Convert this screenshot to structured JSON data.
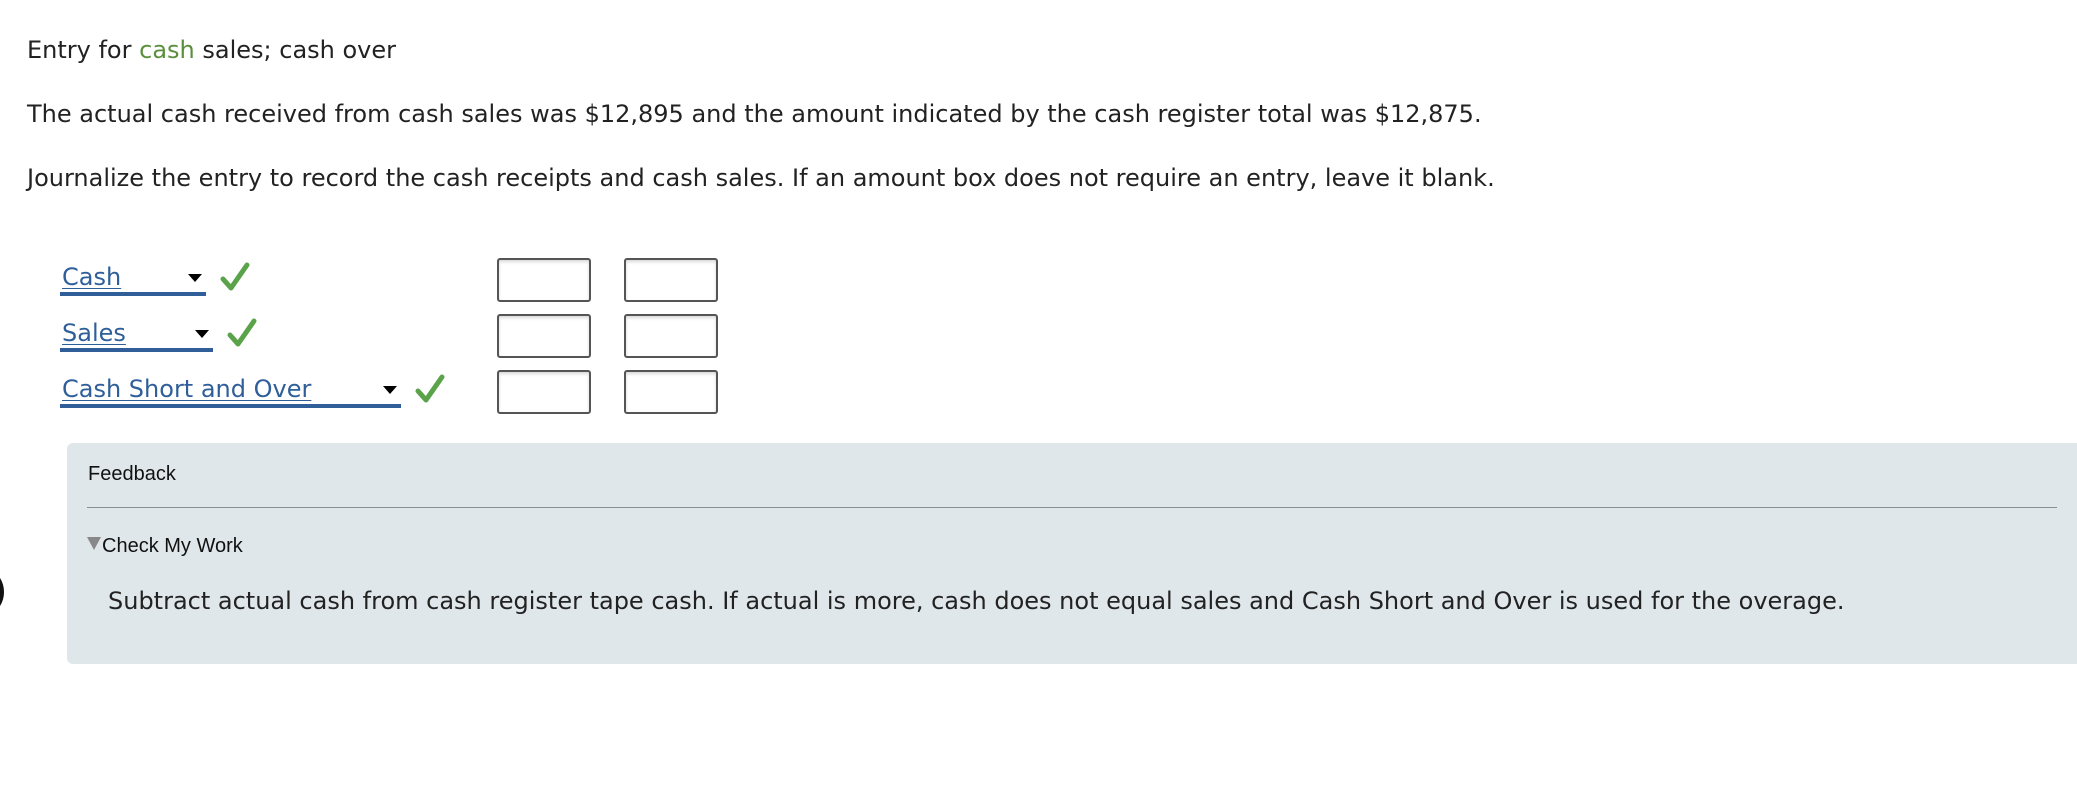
{
  "title": {
    "prefix": "Entry for ",
    "highlight": "cash",
    "suffix": " sales; cash over"
  },
  "paragraphs": {
    "facts": "The actual cash received from cash sales was $12,895 and the amount indicated by the cash register total was $12,875.",
    "instructions": "Journalize the entry to record the cash receipts and cash sales. If an amount box does not require an entry, leave it blank."
  },
  "journal": {
    "rows": [
      {
        "account": "Cash",
        "status": "correct",
        "debit": "",
        "credit": ""
      },
      {
        "account": "Sales",
        "status": "correct",
        "debit": "",
        "credit": ""
      },
      {
        "account": "Cash Short and Over",
        "status": "correct",
        "debit": "",
        "credit": ""
      }
    ]
  },
  "feedback": {
    "heading": "Feedback",
    "toggle_label": "Check My Work",
    "text": "Subtract actual cash from cash register tape cash. If actual is more, cash does not equal sales and Cash Short and Over is used for the overage."
  },
  "colors": {
    "highlight": "#5a8f3c",
    "link": "#2f5e99",
    "check": "#5aa34a",
    "feedback_bg": "#e0e7ea"
  },
  "icons": {
    "check": "check-icon",
    "dropdown": "dropdown-caret-icon",
    "toggle": "triangle-down-icon"
  }
}
